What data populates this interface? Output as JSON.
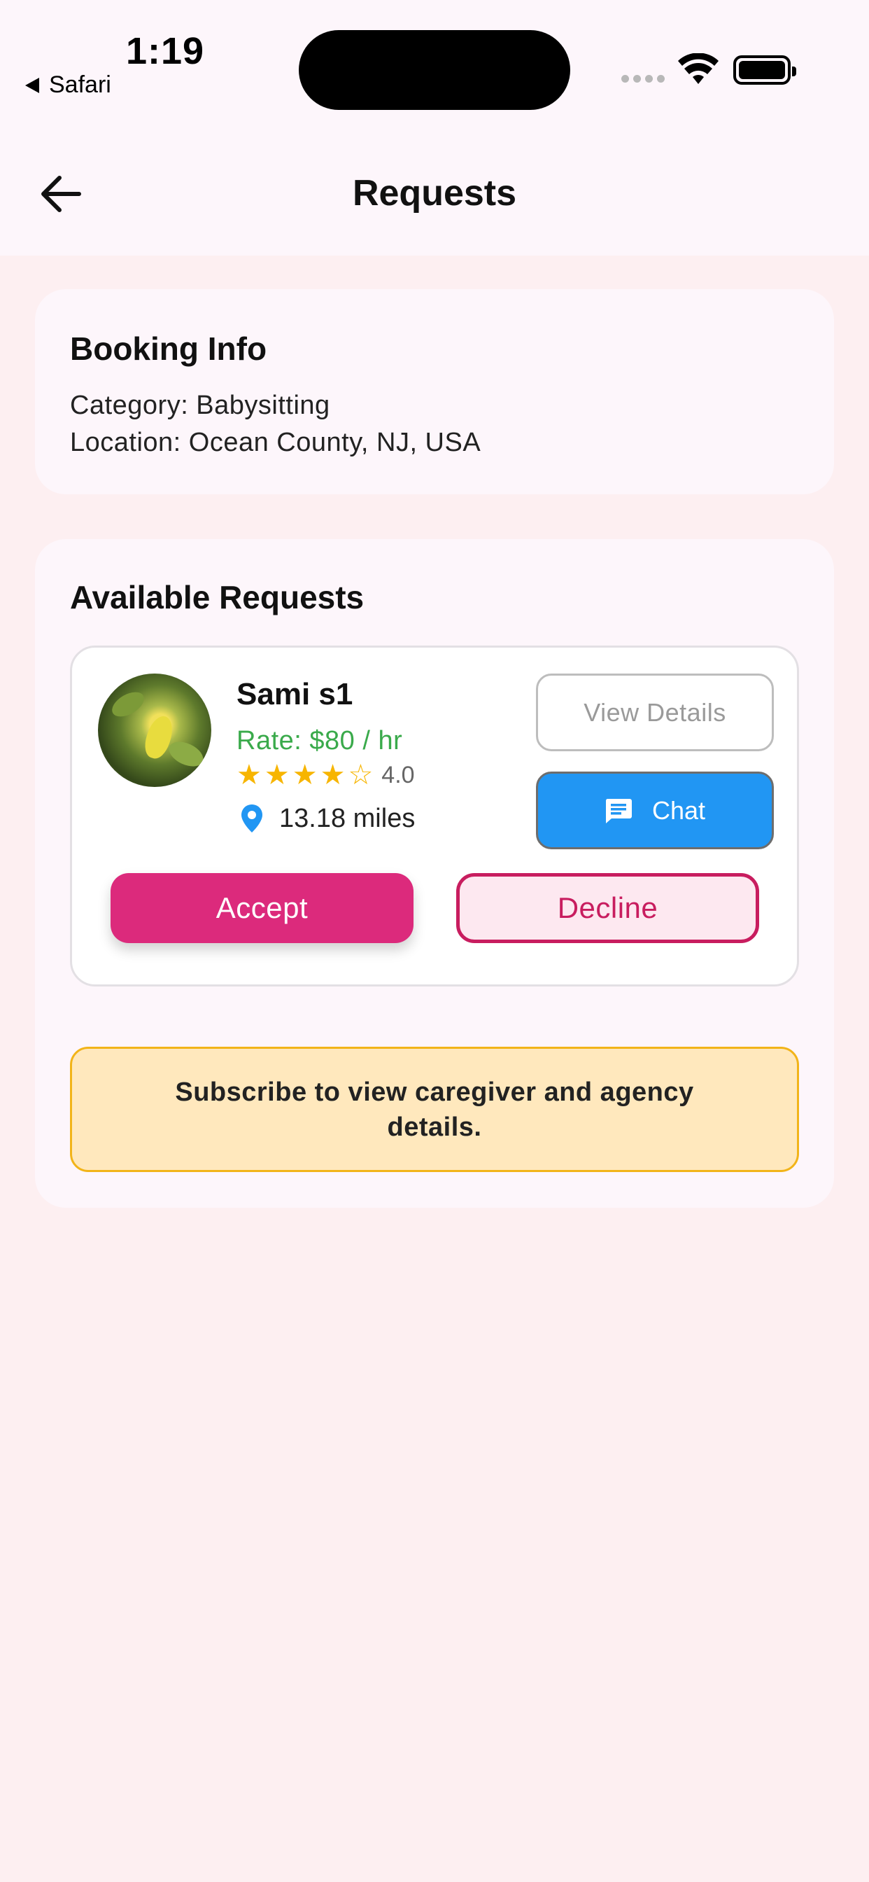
{
  "status_bar": {
    "time": "1:19",
    "back_app": "Safari"
  },
  "app_bar": {
    "title": "Requests",
    "back_icon": "arrow-left-icon"
  },
  "booking_info": {
    "heading": "Booking Info",
    "category": "Category: Babysitting",
    "location": "Location: Ocean County, NJ, USA"
  },
  "available_requests": {
    "heading": "Available Requests",
    "items": [
      {
        "name": "Sami s1",
        "rate": "Rate: $80 / hr",
        "rating": 4.0,
        "rating_label": "4.0",
        "distance": "13.18 miles",
        "view_details_label": "View Details",
        "chat_label": "Chat",
        "accept_label": "Accept",
        "decline_label": "Decline"
      }
    ],
    "notice": "Subscribe to view caregiver and agency details."
  },
  "colors": {
    "accept": "#dc2a7c",
    "decline": "#c81d5f",
    "chat": "#2196f3",
    "rate": "#3aaa4b",
    "star": "#f7b500",
    "notice_bg": "#ffe8bd",
    "notice_border": "#f2b419"
  }
}
